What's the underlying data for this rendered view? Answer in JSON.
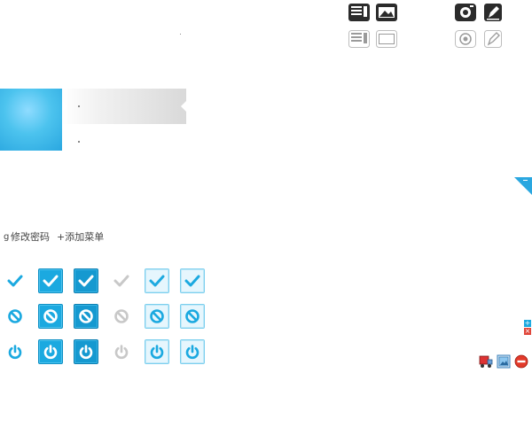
{
  "links": {
    "change_password": "修改密码",
    "add_menu": "+添加菜单",
    "clipped_prefix": "g"
  },
  "colors": {
    "brand_blue": "#1ba9e0",
    "brand_blue_dark": "#0e8fc4",
    "light_blue_bg": "#e6f6fd",
    "gray_icon": "#c8c8c8",
    "dark_icon": "#333333"
  },
  "top_icons": [
    {
      "icon": "document-list-icon",
      "variant": "dark"
    },
    {
      "icon": "image-frame-icon",
      "variant": "dark"
    },
    {
      "icon": "camera-icon",
      "variant": "dark"
    },
    {
      "icon": "edit-pen-icon",
      "variant": "dark"
    },
    {
      "icon": "document-list-icon",
      "variant": "light"
    },
    {
      "icon": "image-frame-icon",
      "variant": "light"
    },
    {
      "icon": "camera-icon",
      "variant": "light"
    },
    {
      "icon": "edit-pen-icon",
      "variant": "light"
    }
  ],
  "icon_grid": [
    {
      "row": "check",
      "states": [
        "plain-blue",
        "solid",
        "solid-dark",
        "plain-gray",
        "light",
        "light"
      ]
    },
    {
      "row": "no-entry",
      "states": [
        "plain-blue",
        "solid",
        "solid-dark",
        "plain-gray",
        "light",
        "light"
      ]
    },
    {
      "row": "power",
      "states": [
        "plain-blue",
        "solid",
        "solid-dark",
        "plain-gray",
        "light",
        "light"
      ]
    }
  ],
  "mini_buttons": {
    "plus": "+",
    "close": "×"
  },
  "bottom_right_icons": [
    "truck-icon",
    "image-icon",
    "remove-icon"
  ]
}
